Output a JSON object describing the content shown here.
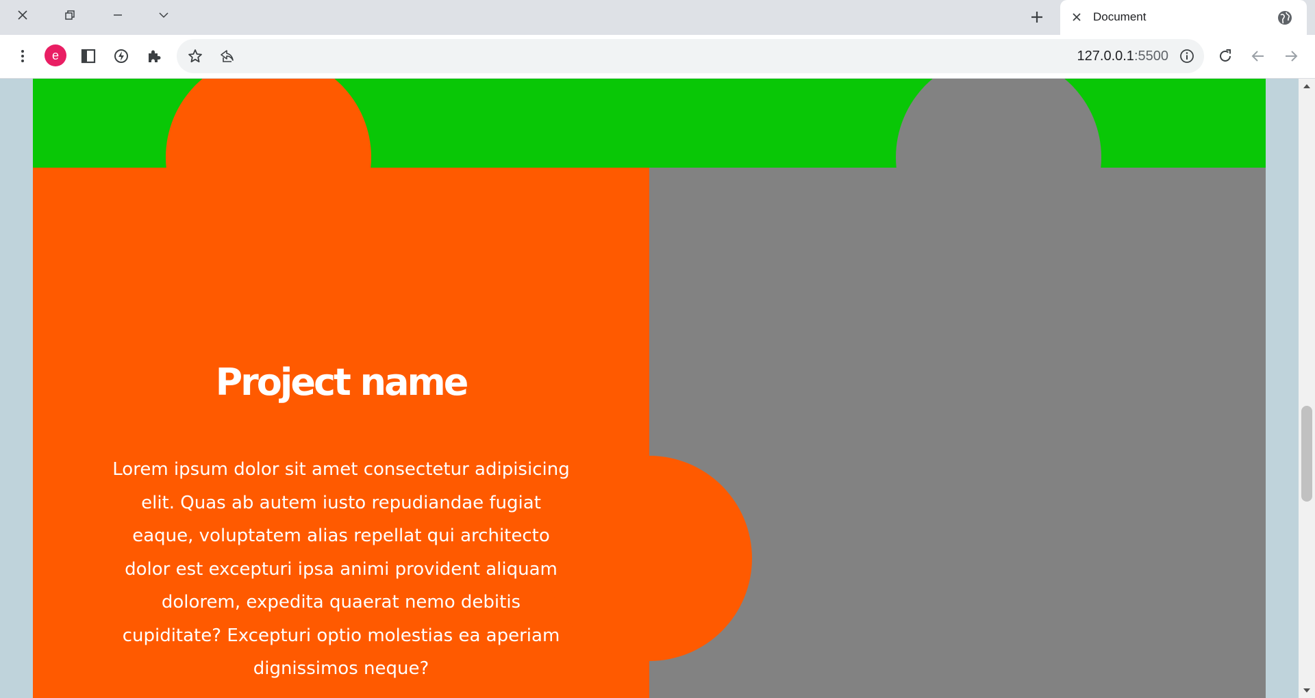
{
  "browser": {
    "tab": {
      "title": "Document"
    },
    "profile": {
      "initial": "e",
      "color": "#e91e63"
    },
    "address_bar": {
      "host": "127.0.0.1",
      "port": ":5500"
    },
    "icons": {
      "window": [
        "close-icon",
        "restore-icon",
        "minimize-icon",
        "chevron-down-icon"
      ],
      "tabstrip": [
        "plus-icon",
        "close-icon",
        "globe-icon"
      ],
      "toolbar": [
        "more-vert-icon",
        "sidebar-icon",
        "performance-icon",
        "extensions-icon",
        "star-icon",
        "share-icon",
        "info-icon",
        "reload-icon",
        "back-icon",
        "forward-icon"
      ]
    }
  },
  "page": {
    "project": {
      "title": "Project name",
      "description": "Lorem ipsum dolor sit amet consectetur adipisicing elit. Quas ab autem iusto repudiandae fugiat eaque, voluptatem alias repellat qui architecto dolor est excepturi ipsa animi provident aliquam dolorem, expedita quaerat nemo debitis cupiditate? Excepturi optio molestias ea aperiam dignissimos neque?"
    },
    "colors": {
      "green": "#09c706",
      "orange": "#ff5a00",
      "gray": "#828282",
      "background": "#bfd3db"
    }
  }
}
